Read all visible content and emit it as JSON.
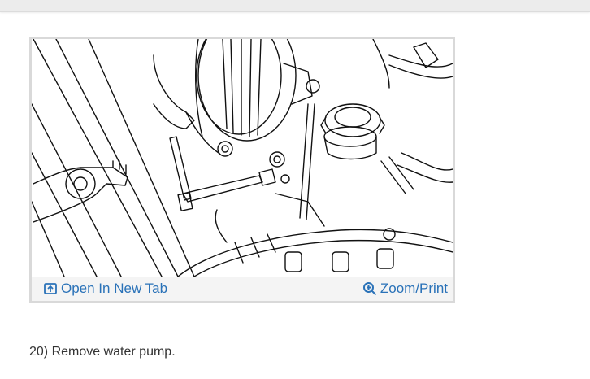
{
  "figure": {
    "open_tab_label": "Open In New Tab",
    "open_tab_icon": "open-in-new-tab-icon",
    "zoom_label": "Zoom/Print",
    "zoom_icon": "zoom-in-icon"
  },
  "step": {
    "text": "20) Remove water pump."
  },
  "colors": {
    "link": "#2a72b8",
    "card_border": "#d9d9d9"
  }
}
